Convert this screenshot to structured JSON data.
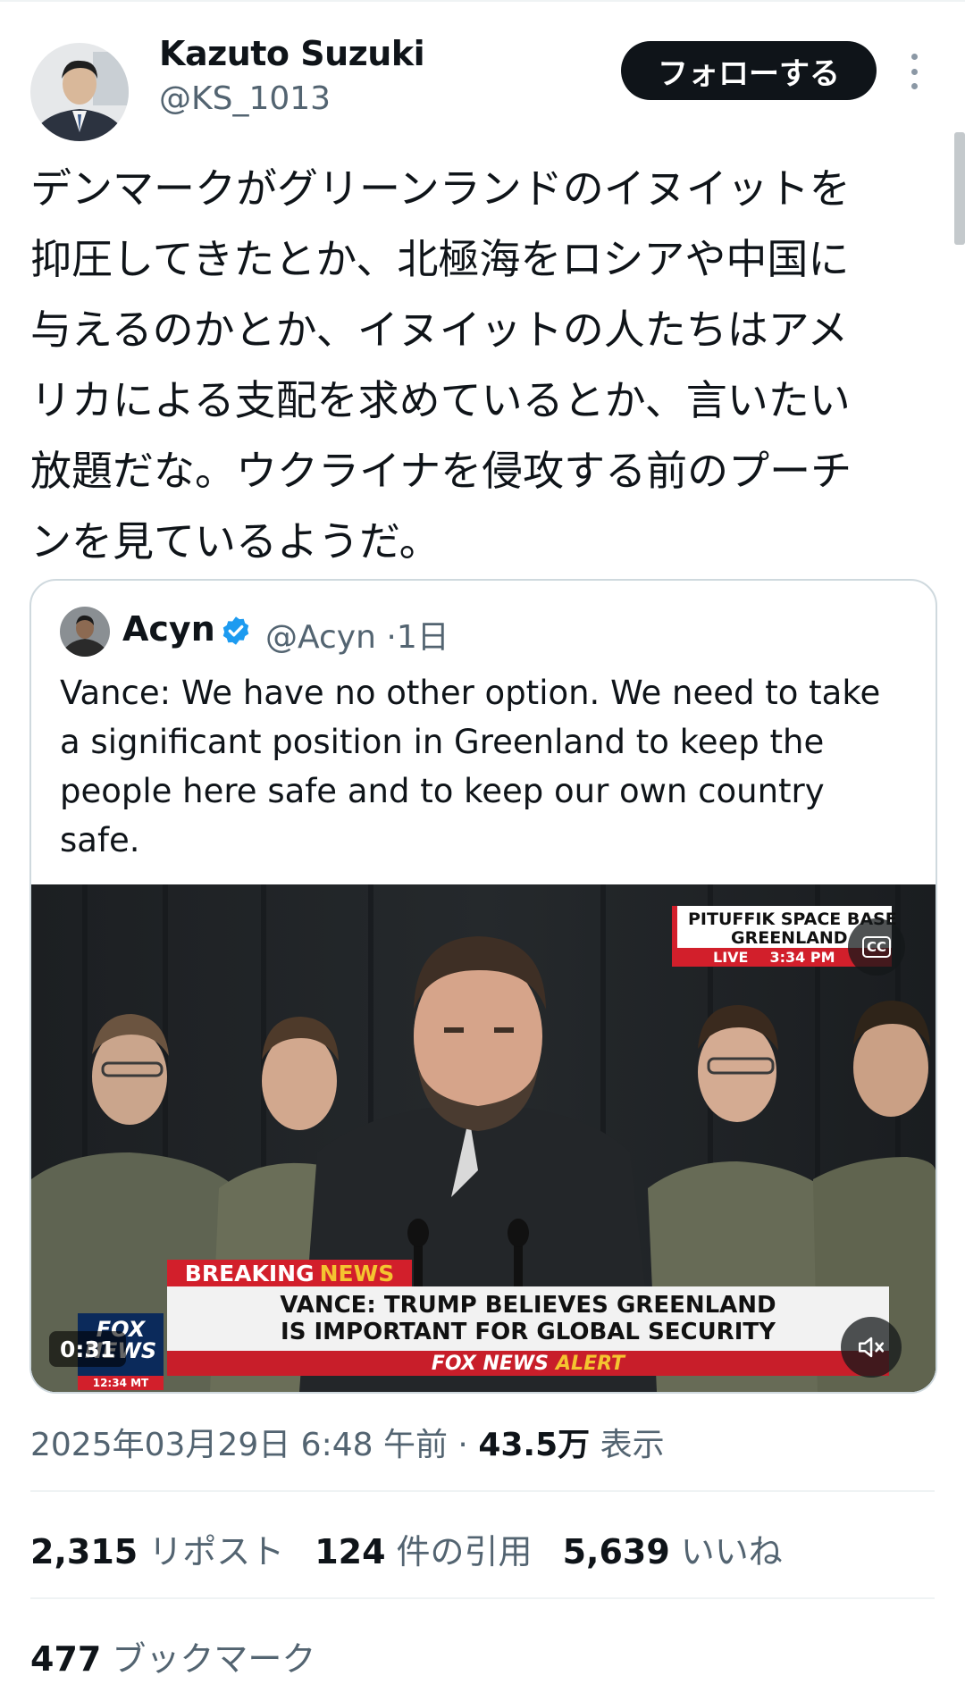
{
  "author": {
    "name": "Kazuto Suzuki",
    "handle": "@KS_1013",
    "follow_label": "フォローする"
  },
  "tweet_lines": [
    "デンマークがグリーンランドのイヌイットを",
    "抑圧してきたとか、北極海をロシアや中国に",
    "与えるのかとか、イヌイットの人たちはアメ",
    "リカによる支配を求めているとか、言いたい",
    "放題だな。ウクライナを侵攻する前のプーチ",
    "ンを見ているようだ。"
  ],
  "quote": {
    "name": "Acyn",
    "handle": "@Acyn",
    "separator": "·",
    "age": "1日",
    "text_lines": [
      "Vance: We have no other option. We need to take",
      "a significant position in Greenland to keep the",
      "people here safe and to keep our own country",
      "safe."
    ],
    "video": {
      "location_line1": "PITUFFIK SPACE BASE",
      "location_line2": "GREENLAND",
      "live_label": "LIVE",
      "live_time": "3:34 PM",
      "breaking_white": "BREAKING",
      "breaking_yellow": "NEWS",
      "headline_line1": "VANCE: TRUMP BELIEVES GREENLAND",
      "headline_line2": "IS IMPORTANT FOR GLOBAL SECURITY",
      "alert_white": "FOX NEWS",
      "alert_yellow": "ALERT",
      "logo_line1": "FOX",
      "logo_line2": "NEWS",
      "logo_time": "12:34 MT",
      "duration": "0:31",
      "cc_label": "CC"
    }
  },
  "meta": {
    "timestamp": "2025年03月29日 6:48 午前",
    "separator": "·",
    "views_count": "43.5万",
    "views_label": "表示"
  },
  "stats": {
    "reposts_count": "2,315",
    "reposts_label": "リポスト",
    "quotes_count": "124",
    "quotes_label": "件の引用",
    "likes_count": "5,639",
    "likes_label": "いいね",
    "bookmarks_count": "477",
    "bookmarks_label": "ブックマーク"
  },
  "colors": {
    "text": "#0f1419",
    "secondary": "#536471",
    "border": "#cfd9de",
    "verified": "#1d9bf0",
    "fox_red": "#d21f2b"
  }
}
